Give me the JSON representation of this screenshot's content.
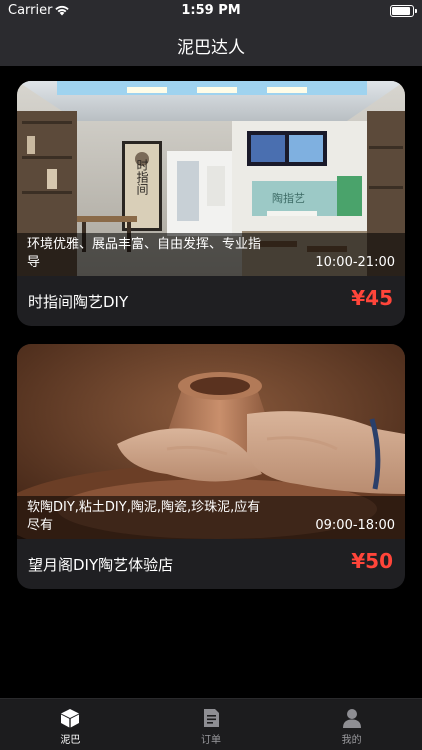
{
  "status_bar": {
    "carrier": "Carrier",
    "time": "1:59 PM"
  },
  "nav": {
    "title": "泥巴达人"
  },
  "shops": [
    {
      "description": "环境优雅、展品丰富、自由发挥、专业指导",
      "hours": "10:00-21:00",
      "name": "时指间陶艺DIY",
      "price": "¥45",
      "photo_sign": "时指间",
      "photo_mural": "陶指艺"
    },
    {
      "description": "软陶DIY,粘土DIY,陶泥,陶瓷,珍珠泥,应有尽有",
      "hours": "09:00-18:00",
      "name": "望月阁DIY陶艺体验店",
      "price": "¥50"
    }
  ],
  "tabs": [
    {
      "label": "泥巴",
      "icon": "cube-icon",
      "active": true
    },
    {
      "label": "订单",
      "icon": "document-icon",
      "active": false
    },
    {
      "label": "我的",
      "icon": "person-icon",
      "active": false
    }
  ],
  "colors": {
    "price": "#ff453a",
    "bar": "#2b2b2f",
    "card": "#1f1f22"
  }
}
